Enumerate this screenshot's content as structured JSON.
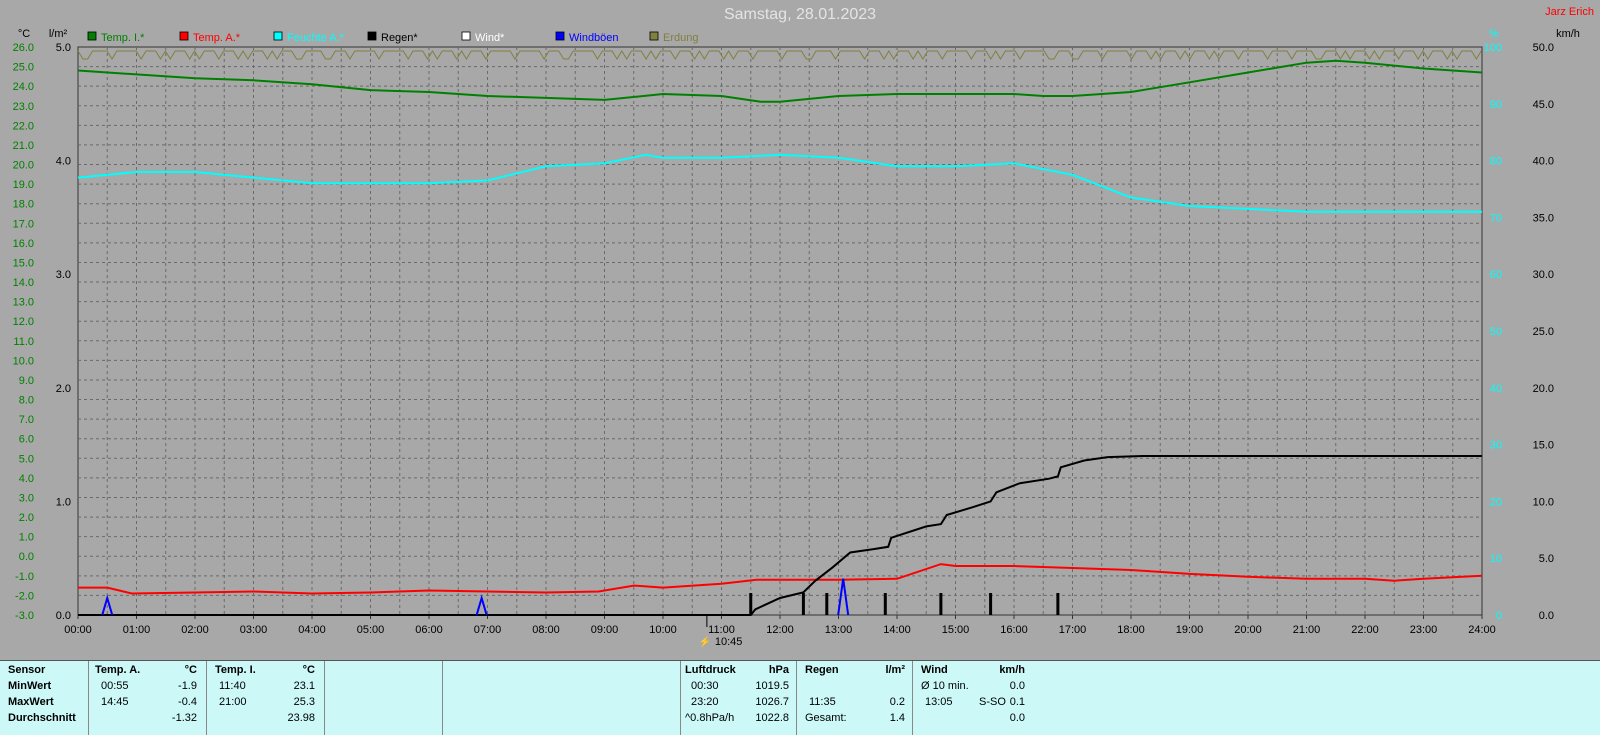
{
  "header": {
    "title": "Samstag, 28.01.2023",
    "author": "Jarz Erich"
  },
  "axes": {
    "left_unit_temp": "°C",
    "left_unit_rain": "l/m²",
    "right_unit_humidity": "%",
    "right_unit_wind": "km/h"
  },
  "legend": [
    {
      "label": "Temp. I.*",
      "color": "#008000"
    },
    {
      "label": "Temp. A.*",
      "color": "#ff0000"
    },
    {
      "label": "Feuchte A.*",
      "color": "#00ffff"
    },
    {
      "label": "Regen*",
      "color": "#000000"
    },
    {
      "label": "Wind*",
      "color": "#ffffff"
    },
    {
      "label": "Windböen",
      "color": "#0000ff"
    },
    {
      "label": "Erdung",
      "color": "#808040"
    }
  ],
  "chart_data": {
    "type": "line",
    "title": "Samstag, 28.01.2023",
    "x_ticks": [
      "00:00",
      "01:00",
      "02:00",
      "03:00",
      "04:00",
      "05:00",
      "06:00",
      "07:00",
      "08:00",
      "09:00",
      "10:00",
      "11:00",
      "12:00",
      "13:00",
      "14:00",
      "15:00",
      "16:00",
      "17:00",
      "18:00",
      "19:00",
      "20:00",
      "21:00",
      "22:00",
      "23:00",
      "24:00"
    ],
    "x_range_hours": [
      0,
      24
    ],
    "temp_axis": {
      "range": [
        -3.0,
        26.0
      ],
      "ticks": [
        "26.0",
        "25.0",
        "24.0",
        "23.0",
        "22.0",
        "21.0",
        "20.0",
        "19.0",
        "18.0",
        "17.0",
        "16.0",
        "15.0",
        "14.0",
        "13.0",
        "12.0",
        "11.0",
        "10.0",
        "9.0",
        "8.0",
        "7.0",
        "6.0",
        "5.0",
        "4.0",
        "3.0",
        "2.0",
        "1.0",
        "0.0",
        "-1.0",
        "-2.0",
        "-3.0"
      ]
    },
    "rain_axis": {
      "range": [
        0.0,
        5.0
      ],
      "ticks": [
        "5.0",
        "4.0",
        "3.0",
        "2.0",
        "1.0",
        "0.0"
      ]
    },
    "humidity_axis": {
      "range": [
        0,
        100
      ],
      "ticks": [
        "100",
        "90",
        "80",
        "70",
        "60",
        "50",
        "40",
        "30",
        "20",
        "10",
        "0"
      ]
    },
    "wind_axis": {
      "range": [
        0.0,
        50.0
      ],
      "ticks": [
        "50.0",
        "45.0",
        "40.0",
        "35.0",
        "30.0",
        "25.0",
        "20.0",
        "15.0",
        "10.0",
        "5.0",
        "0.0"
      ]
    },
    "marker": "10:45",
    "series": [
      {
        "name": "Temp. I.*",
        "axis": "temp",
        "color": "#008000",
        "points": [
          [
            0,
            24.8
          ],
          [
            1,
            24.6
          ],
          [
            2,
            24.4
          ],
          [
            3,
            24.3
          ],
          [
            4,
            24.1
          ],
          [
            5,
            23.8
          ],
          [
            6,
            23.7
          ],
          [
            7,
            23.5
          ],
          [
            8,
            23.4
          ],
          [
            9,
            23.3
          ],
          [
            10,
            23.6
          ],
          [
            11,
            23.5
          ],
          [
            11.67,
            23.2
          ],
          [
            12,
            23.2
          ],
          [
            13,
            23.5
          ],
          [
            14,
            23.6
          ],
          [
            15,
            23.6
          ],
          [
            16,
            23.6
          ],
          [
            16.5,
            23.5
          ],
          [
            17,
            23.5
          ],
          [
            18,
            23.7
          ],
          [
            19,
            24.2
          ],
          [
            20,
            24.7
          ],
          [
            21,
            25.2
          ],
          [
            21.5,
            25.3
          ],
          [
            22,
            25.2
          ],
          [
            23,
            24.9
          ],
          [
            24,
            24.7
          ]
        ]
      },
      {
        "name": "Temp. A.*",
        "axis": "temp",
        "color": "#ff0000",
        "points": [
          [
            0,
            -1.6
          ],
          [
            0.5,
            -1.6
          ],
          [
            0.92,
            -1.9
          ],
          [
            2,
            -1.85
          ],
          [
            3,
            -1.8
          ],
          [
            4,
            -1.9
          ],
          [
            5,
            -1.85
          ],
          [
            6,
            -1.75
          ],
          [
            7,
            -1.8
          ],
          [
            8,
            -1.85
          ],
          [
            8.9,
            -1.8
          ],
          [
            9.5,
            -1.5
          ],
          [
            10,
            -1.6
          ],
          [
            11,
            -1.4
          ],
          [
            11.6,
            -1.2
          ],
          [
            12,
            -1.2
          ],
          [
            13,
            -1.2
          ],
          [
            14,
            -1.15
          ],
          [
            14.75,
            -0.4
          ],
          [
            15,
            -0.5
          ],
          [
            16,
            -0.5
          ],
          [
            17,
            -0.6
          ],
          [
            18,
            -0.7
          ],
          [
            19,
            -0.9
          ],
          [
            20,
            -1.05
          ],
          [
            21,
            -1.15
          ],
          [
            22,
            -1.15
          ],
          [
            22.5,
            -1.25
          ],
          [
            23,
            -1.15
          ],
          [
            24,
            -1.0
          ]
        ]
      },
      {
        "name": "Feuchte A.*",
        "axis": "humidity",
        "color": "#00ffff",
        "points": [
          [
            0,
            77
          ],
          [
            1,
            78
          ],
          [
            2,
            78
          ],
          [
            3,
            77
          ],
          [
            4,
            76
          ],
          [
            5,
            76
          ],
          [
            6,
            76
          ],
          [
            7,
            76.5
          ],
          [
            8,
            79
          ],
          [
            9,
            79.5
          ],
          [
            9.7,
            81
          ],
          [
            10,
            80.5
          ],
          [
            11,
            80.5
          ],
          [
            12,
            81
          ],
          [
            13,
            80.5
          ],
          [
            14,
            79
          ],
          [
            15,
            79
          ],
          [
            16,
            79.5
          ],
          [
            17,
            77.5
          ],
          [
            18,
            73.5
          ],
          [
            19,
            72
          ],
          [
            20,
            71.5
          ],
          [
            21,
            71
          ],
          [
            22,
            71
          ],
          [
            23,
            71
          ],
          [
            24,
            71
          ]
        ]
      },
      {
        "name": "Regen*",
        "axis": "rain",
        "color": "#000000",
        "points": [
          [
            0,
            0
          ],
          [
            11.5,
            0
          ],
          [
            11.58,
            0.05
          ],
          [
            12,
            0.15
          ],
          [
            12.4,
            0.2
          ],
          [
            12.6,
            0.3
          ],
          [
            12.9,
            0.42
          ],
          [
            13.2,
            0.55
          ],
          [
            13.6,
            0.58
          ],
          [
            13.85,
            0.6
          ],
          [
            13.9,
            0.68
          ],
          [
            14.5,
            0.78
          ],
          [
            14.75,
            0.8
          ],
          [
            14.85,
            0.88
          ],
          [
            15.3,
            0.95
          ],
          [
            15.6,
            1.0
          ],
          [
            15.7,
            1.08
          ],
          [
            16.1,
            1.16
          ],
          [
            16.6,
            1.2
          ],
          [
            16.75,
            1.22
          ],
          [
            16.8,
            1.3
          ],
          [
            17.2,
            1.36
          ],
          [
            17.6,
            1.39
          ],
          [
            18.2,
            1.4
          ],
          [
            24,
            1.4
          ]
        ]
      },
      {
        "name": "Windböen",
        "axis": "wind",
        "color": "#0000ff",
        "spikes": [
          [
            0.5,
            1.5
          ],
          [
            6.9,
            1.5
          ],
          [
            13.08,
            3.2
          ]
        ]
      }
    ],
    "rain_bars": [
      11.5,
      12.4,
      12.8,
      13.8,
      14.75,
      15.6,
      16.75
    ]
  },
  "panel": {
    "sensor": {
      "header": "Sensor",
      "rows": [
        "MinWert",
        "MaxWert",
        "Durchschnitt"
      ]
    },
    "temp_a": {
      "header": "Temp. A.",
      "unit": "°C",
      "min_time": "00:55",
      "min_value": "-1.9",
      "max_time": "14:45",
      "max_value": "-0.4",
      "avg_value": "-1.32"
    },
    "temp_i": {
      "header": "Temp. I.",
      "unit": "°C",
      "min_time": "11:40",
      "min_value": "23.1",
      "max_time": "21:00",
      "max_value": "25.3",
      "avg_value": "23.98"
    },
    "pressure": {
      "header": "Luftdruck",
      "unit": "hPa",
      "min_time": "00:30",
      "min_value": "1019.5",
      "max_time": "23:20",
      "max_value": "1026.7",
      "trend": "^0.8hPa/h",
      "avg_value": "1022.8"
    },
    "rain": {
      "header": "Regen",
      "unit": "l/m²",
      "max_time": "11:35",
      "max_value": "0.2",
      "total_label": "Gesamt:",
      "total_value": "1.4"
    },
    "wind": {
      "header": "Wind",
      "unit": "km/h",
      "avg_label": "Ø 10 min.",
      "avg_value": "0.0",
      "max_time": "13:05",
      "max_dir": "S-SO",
      "max_value": "0.1",
      "last_value": "0.0"
    }
  }
}
